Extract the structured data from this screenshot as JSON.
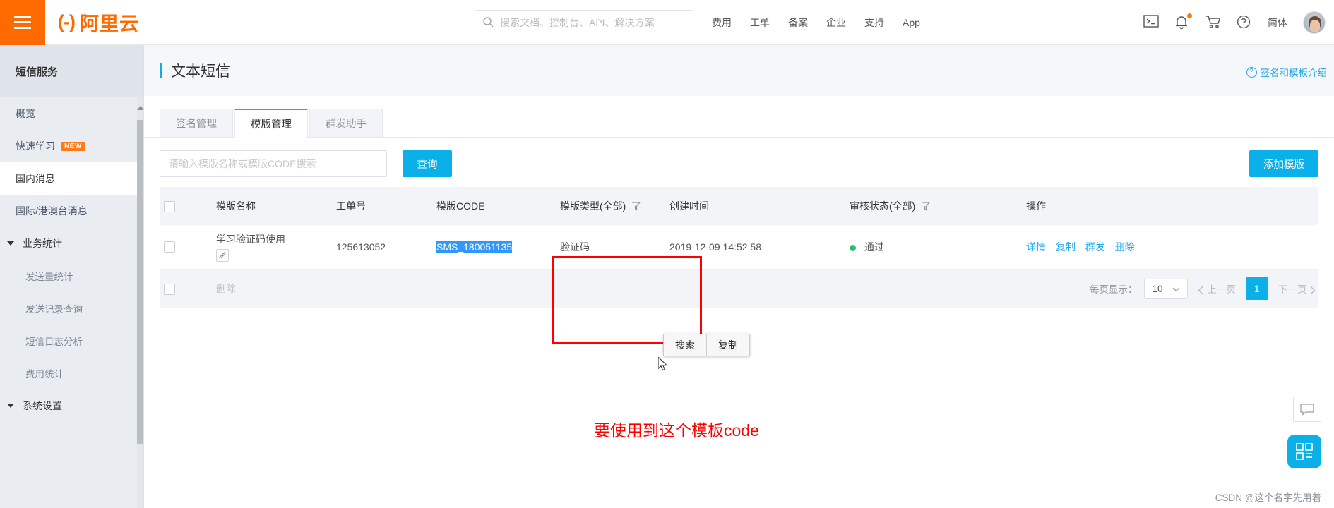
{
  "topbar": {
    "logo_mark": "(-)",
    "logo_word": "阿里云",
    "search_placeholder": "搜索文档、控制台、API、解决方案",
    "search_value": "",
    "nav": [
      {
        "label": "费用"
      },
      {
        "label": "工单"
      },
      {
        "label": "备案"
      },
      {
        "label": "企业"
      },
      {
        "label": "支持"
      },
      {
        "label": "App"
      }
    ],
    "lang": "简体",
    "icons": [
      "terminal-icon",
      "bell-icon",
      "cart-icon",
      "help-icon"
    ]
  },
  "sidebar": {
    "title": "短信服务",
    "items": [
      {
        "label": "概览",
        "type": "item",
        "active": false
      },
      {
        "label": "快速学习",
        "type": "item",
        "badge": "NEW",
        "active": false
      },
      {
        "label": "国内消息",
        "type": "item",
        "active": true
      },
      {
        "label": "国际/港澳台消息",
        "type": "item",
        "active": false
      },
      {
        "label": "业务统计",
        "type": "group",
        "active": false
      },
      {
        "label": "发送量统计",
        "type": "sub",
        "active": false
      },
      {
        "label": "发送记录查询",
        "type": "sub",
        "active": false
      },
      {
        "label": "短信日志分析",
        "type": "sub",
        "active": false
      },
      {
        "label": "费用统计",
        "type": "sub",
        "active": false
      },
      {
        "label": "系统设置",
        "type": "group",
        "active": false
      }
    ]
  },
  "page": {
    "title": "文本短信",
    "help_link": "签名和模板介绍"
  },
  "tabs": [
    {
      "label": "签名管理",
      "active": false
    },
    {
      "label": "模版管理",
      "active": true
    },
    {
      "label": "群发助手",
      "active": false
    }
  ],
  "toolbar": {
    "search_placeholder": "请输入模版名称或模版CODE搜索",
    "search_value": "",
    "query_label": "查询",
    "add_label": "添加模版"
  },
  "table": {
    "headers": [
      {
        "label": "模版名称"
      },
      {
        "label": "工单号"
      },
      {
        "label": "模版CODE"
      },
      {
        "label": "模版类型(全部)",
        "filter": true
      },
      {
        "label": "创建时间"
      },
      {
        "label": "审核状态(全部)",
        "filter": true
      },
      {
        "label": "操作"
      }
    ],
    "rows": [
      {
        "name": "学习验证码使用",
        "ticket": "125613052",
        "code": "SMS_180051135",
        "type": "验证码",
        "created": "2019-12-09 14:52:58",
        "status": "通过",
        "status_color": "#29c26b",
        "ops": [
          "详情",
          "复制",
          "群发",
          "删除"
        ]
      }
    ],
    "footer": {
      "delete_label": "删除",
      "page_size_label": "每页显示：",
      "page_size_value": "10",
      "prev_label": "上一页",
      "current_page": "1",
      "next_label": "下一页"
    }
  },
  "context_menu": {
    "items": [
      "搜索",
      "复制"
    ]
  },
  "annotation": {
    "note": "要使用到这个模板code",
    "color": "#ff0000"
  },
  "watermark": "CSDN @这个名字先用着",
  "floating": {
    "chat_icon": "chat-icon",
    "qr_icon": "qrcode-icon"
  }
}
